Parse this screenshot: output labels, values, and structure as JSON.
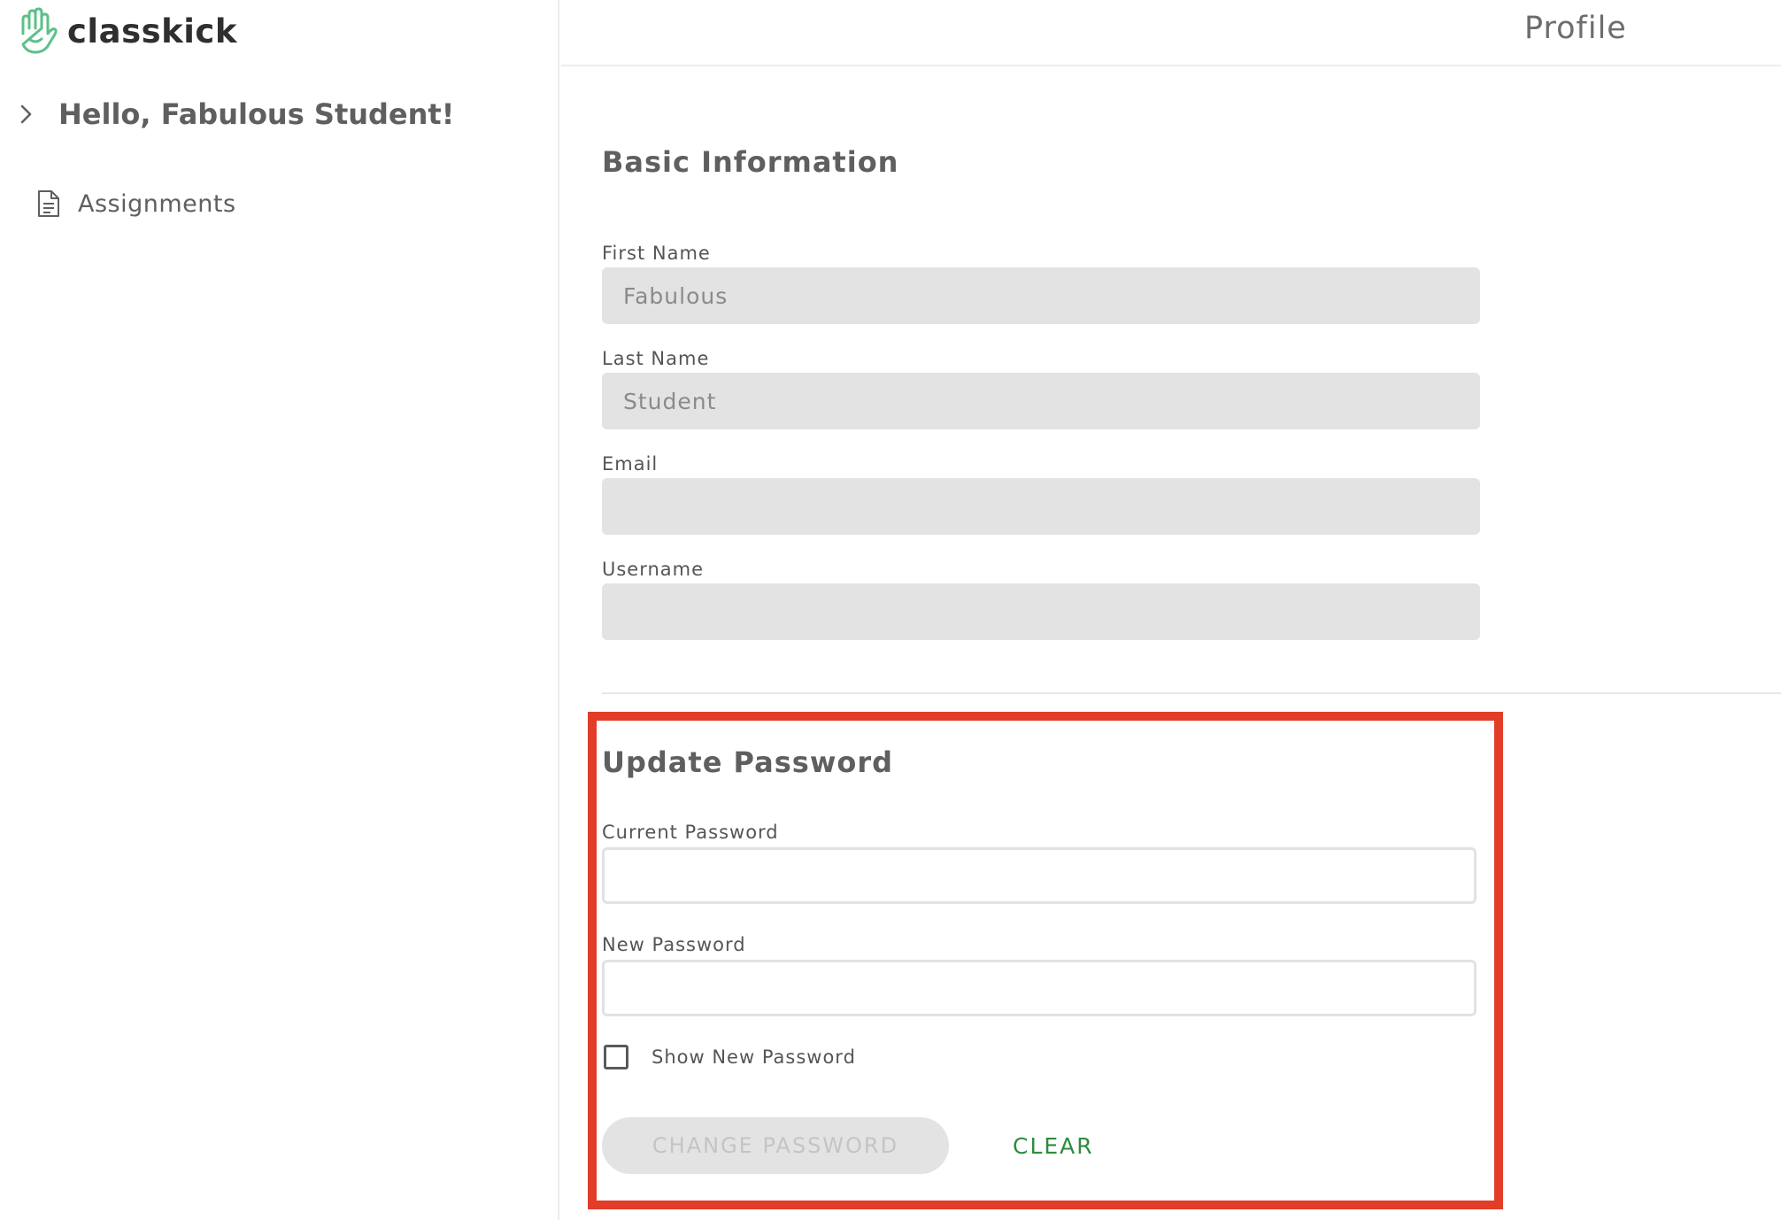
{
  "app": {
    "name": "classkick",
    "brand_color": "#5cc08a"
  },
  "sidebar": {
    "greeting": "Hello, Fabulous Student!",
    "items": [
      {
        "label": "Assignments",
        "icon": "document-icon"
      }
    ]
  },
  "header": {
    "title": "Profile"
  },
  "basic_info": {
    "title": "Basic Information",
    "fields": [
      {
        "label": "First Name",
        "value": "Fabulous"
      },
      {
        "label": "Last Name",
        "value": "Student"
      },
      {
        "label": "Email",
        "value": ""
      },
      {
        "label": "Username",
        "value": ""
      }
    ]
  },
  "update_password": {
    "title": "Update Password",
    "current_label": "Current Password",
    "current_value": "",
    "new_label": "New Password",
    "new_value": "",
    "show_label": "Show New Password",
    "show_checked": false,
    "change_button": "CHANGE PASSWORD",
    "clear_button": "CLEAR",
    "highlight_color": "#e23d28",
    "clear_color": "#2e8b3f"
  }
}
